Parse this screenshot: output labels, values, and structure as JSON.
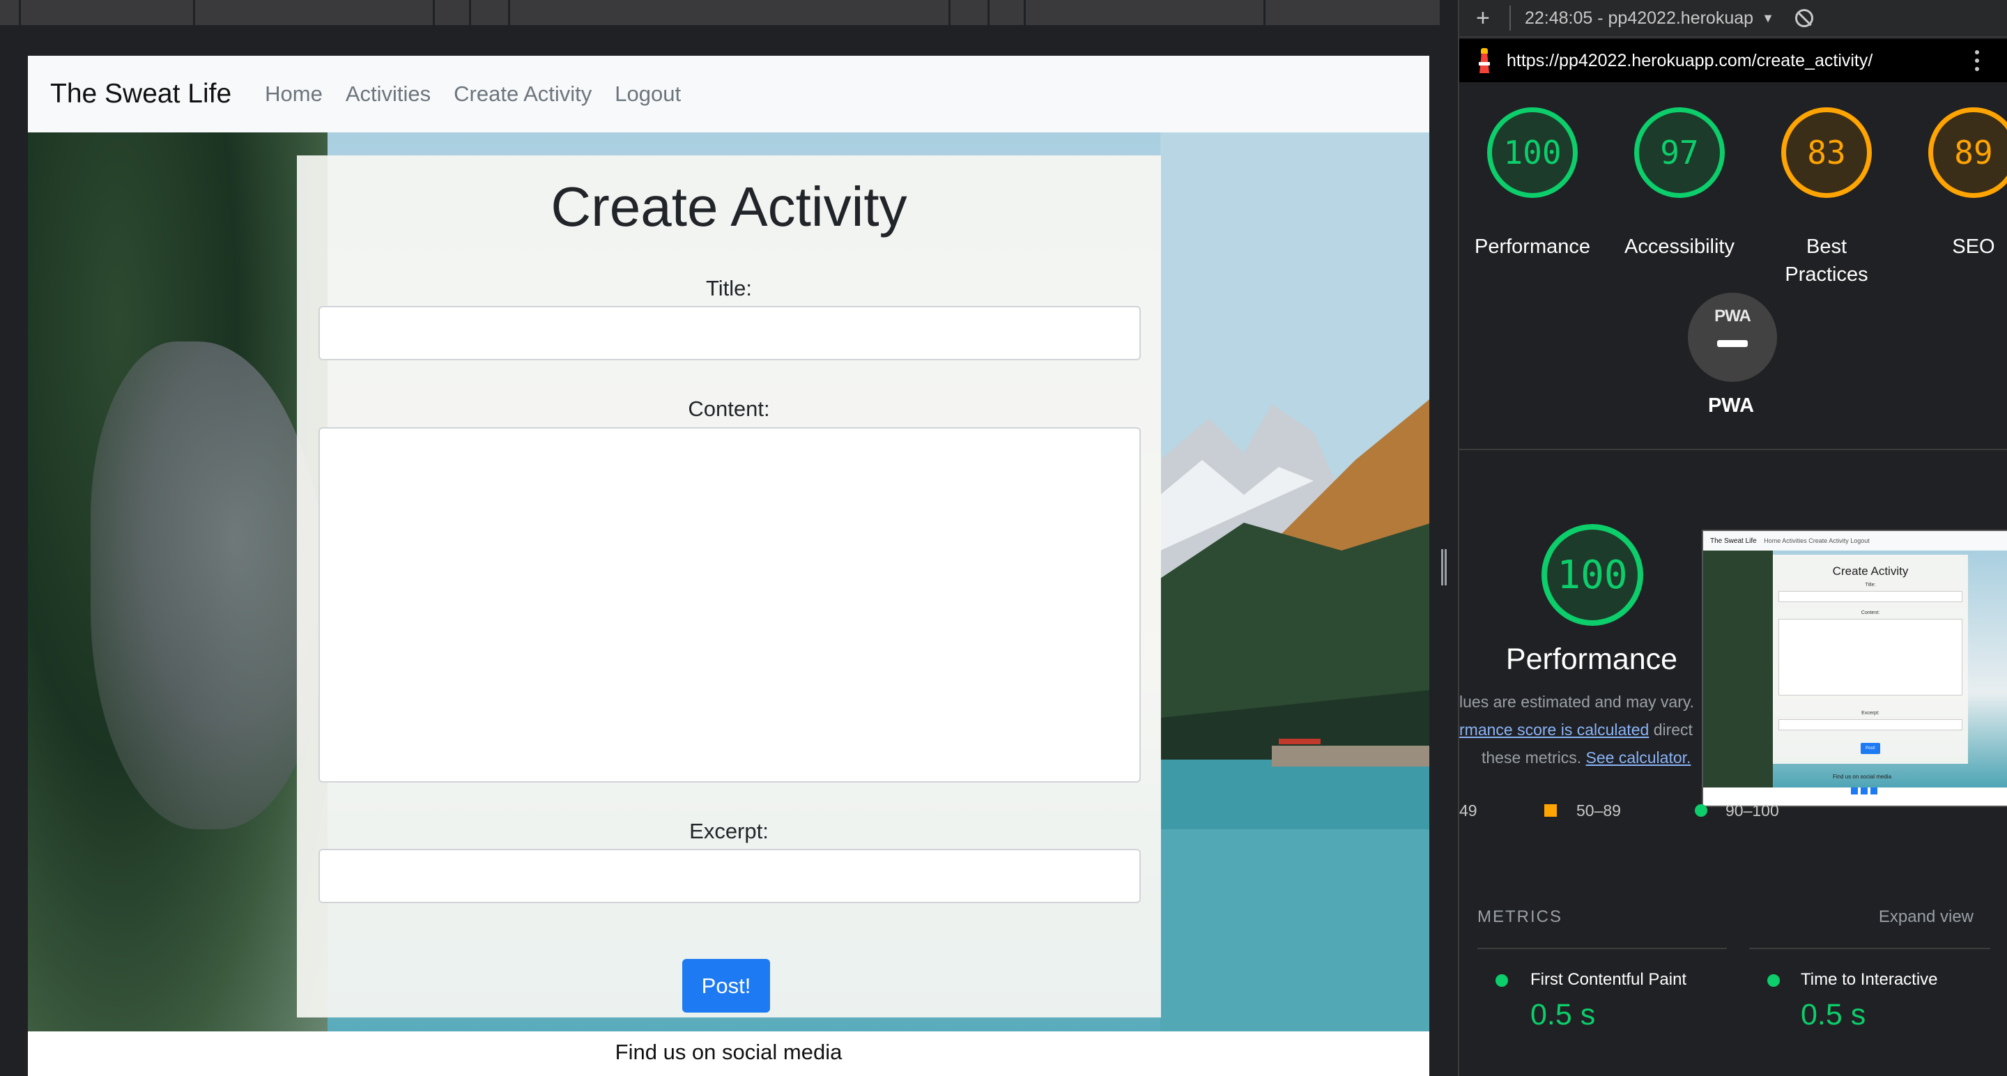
{
  "site": {
    "brand": "The Sweat Life",
    "nav": [
      "Home",
      "Activities",
      "Create Activity",
      "Logout"
    ],
    "form": {
      "title": "Create Activity",
      "title_label": "Title:",
      "content_label": "Content:",
      "excerpt_label": "Excerpt:",
      "title_value": "",
      "content_value": "",
      "excerpt_value": "",
      "submit_label": "Post!"
    },
    "footer_text": "Find us on social media"
  },
  "lighthouse": {
    "session": "22:48:05 - pp42022.herokuap",
    "url": "https://pp42022.herokuapp.com/create_activity/",
    "scores": [
      {
        "label": "Performance",
        "value": "100",
        "status": "pass"
      },
      {
        "label": "Accessibility",
        "value": "97",
        "status": "pass"
      },
      {
        "label": "Best Practices",
        "value": "83",
        "status": "average"
      },
      {
        "label": "SEO",
        "value": "89",
        "status": "average"
      }
    ],
    "pwa_badge": "PWA",
    "pwa_label": "PWA",
    "perf_score": "100",
    "perf_title": "Performance",
    "desc_line1": "lues are estimated and may vary.",
    "desc_line2_link": "rmance score is calculated",
    "desc_line2_rest": "direct",
    "desc_line3": "these metrics.",
    "desc_line3_link": "See calculator.",
    "legend": {
      "fail": "49",
      "average": "50–89",
      "pass": "90–100"
    },
    "metrics_header": "METRICS",
    "expand_label": "Expand view",
    "metrics": [
      {
        "name": "First Contentful Paint",
        "value": "0.5 s"
      },
      {
        "name": "Time to Interactive",
        "value": "0.5 s"
      }
    ],
    "thumbnail": {
      "brand": "The Sweat Life",
      "nav": "Home   Activities   Create Activity   Logout",
      "title": "Create Activity",
      "title_label": "Title:",
      "content_label": "Content:",
      "excerpt_label": "Excerpt:",
      "button": "Post!",
      "footer": "Find us on social media"
    }
  },
  "colors": {
    "pass": "#0cce6b",
    "average": "#ffa400",
    "primary_button": "#1d7af2",
    "link": "#8ab4f8"
  }
}
